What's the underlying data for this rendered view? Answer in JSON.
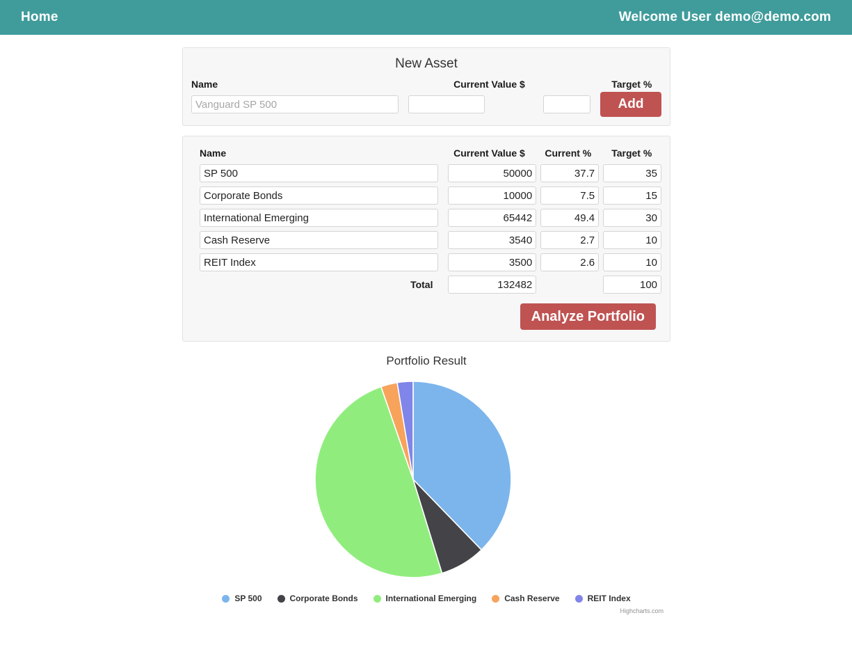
{
  "navbar": {
    "brand": "Home",
    "user_text": "Welcome User demo@demo.com",
    "background": "#3f9c9b"
  },
  "new_asset": {
    "title": "New Asset",
    "labels": {
      "name": "Name",
      "current_value": "Current Value $",
      "target_pct": "Target %"
    },
    "inputs": {
      "name_placeholder": "Vanguard SP 500",
      "name_value": "",
      "current_value": "",
      "target_pct": ""
    },
    "add_label": "Add",
    "add_color": "#bf5352"
  },
  "portfolio_table": {
    "headers": {
      "name": "Name",
      "current_value": "Current Value $",
      "current_pct": "Current %",
      "target_pct": "Target %"
    },
    "rows": [
      {
        "name": "SP 500",
        "current_value": "50000",
        "current_pct": "37.7",
        "target_pct": "35"
      },
      {
        "name": "Corporate Bonds",
        "current_value": "10000",
        "current_pct": "7.5",
        "target_pct": "15"
      },
      {
        "name": "International Emerging",
        "current_value": "65442",
        "current_pct": "49.4",
        "target_pct": "30"
      },
      {
        "name": "Cash Reserve",
        "current_value": "3540",
        "current_pct": "2.7",
        "target_pct": "10"
      },
      {
        "name": "REIT Index",
        "current_value": "3500",
        "current_pct": "2.6",
        "target_pct": "10"
      }
    ],
    "total": {
      "label": "Total",
      "current_value": "132482",
      "target_pct": "100"
    },
    "analyze_label": "Analyze Portfolio",
    "analyze_color": "#bf5352"
  },
  "chart_data": {
    "type": "pie",
    "title": "Portfolio Result",
    "xlabel": "",
    "ylabel": "",
    "legend_position": "bottom",
    "grid": false,
    "categories": [
      "SP 500",
      "Corporate Bonds",
      "International Emerging",
      "Cash Reserve",
      "REIT Index"
    ],
    "values": [
      37.7,
      7.5,
      49.4,
      2.7,
      2.6
    ],
    "raw_values": [
      50000,
      10000,
      65442,
      3540,
      3500
    ],
    "colors": [
      "#7cb5ec",
      "#434348",
      "#90ed7d",
      "#f7a35c",
      "#8085e9"
    ],
    "slices": [
      {
        "name": "SP 500",
        "value": 37.7,
        "color": "#7cb5ec"
      },
      {
        "name": "Corporate Bonds",
        "value": 7.5,
        "color": "#434348"
      },
      {
        "name": "International Emerging",
        "value": 49.4,
        "color": "#90ed7d"
      },
      {
        "name": "Cash Reserve",
        "value": 2.7,
        "color": "#f7a35c"
      },
      {
        "name": "REIT Index",
        "value": 2.6,
        "color": "#8085e9"
      }
    ],
    "credits": "Highcharts.com"
  }
}
